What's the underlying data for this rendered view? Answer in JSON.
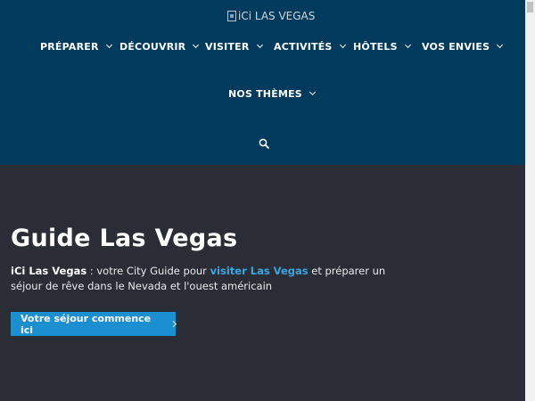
{
  "header": {
    "logo_alt": "iCi LAS VEGAS",
    "nav": [
      {
        "label": "PRÉPARER"
      },
      {
        "label": "DÉCOUVRIR"
      },
      {
        "label": "VISITER"
      },
      {
        "label": "ACTIVITÉS"
      },
      {
        "label": "HÔTELS"
      },
      {
        "label": "VOS ENVIES"
      },
      {
        "label": "NOS THÈMES"
      }
    ]
  },
  "hero": {
    "title": "Guide Las Vegas",
    "text_brand": "iCi Las Vegas",
    "text_part1": " : votre City Guide pour ",
    "text_link": "visiter Las Vegas",
    "text_part2": " et préparer un séjour de rêve dans le Nevada et l'ouest américain",
    "cta_label": "Votre séjour commence ici"
  },
  "colors": {
    "header_bg": "#003a5c",
    "hero_bg": "#2b2d36",
    "accent": "#1b8fcf",
    "link": "#3aa6df"
  },
  "icons": {
    "search": "search-icon",
    "chevron": "chevron-down-icon"
  }
}
